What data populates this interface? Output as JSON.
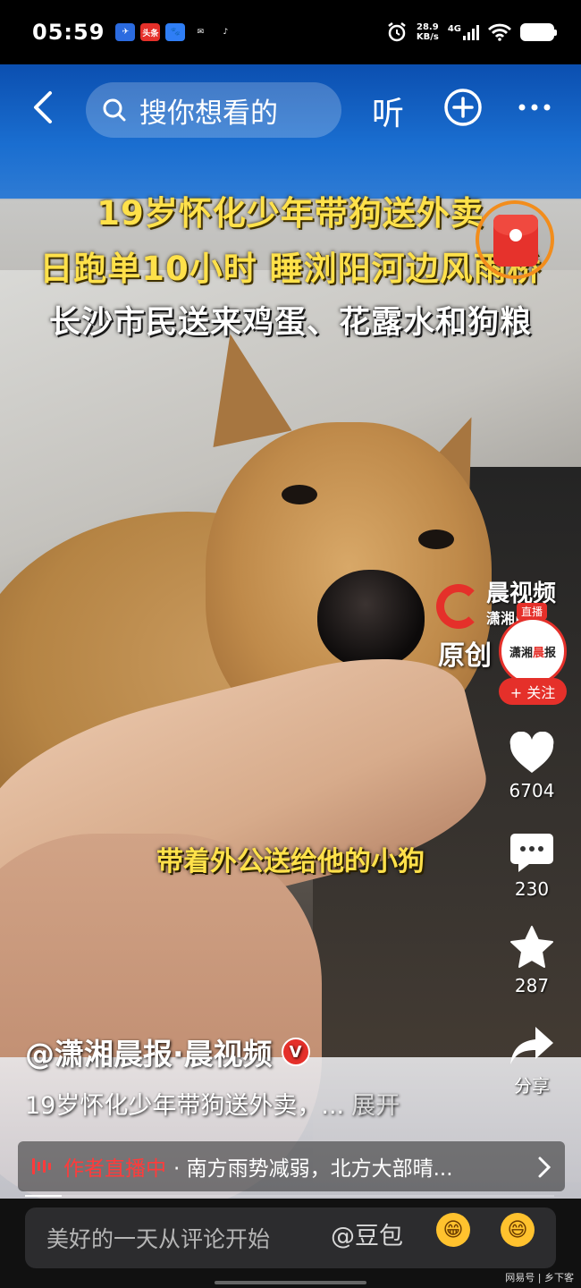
{
  "status_bar": {
    "time": "05:59",
    "apps": [
      {
        "name": "app-icon",
        "color": "#2b6be0",
        "label": ""
      },
      {
        "name": "toutiao-icon",
        "color": "#e5302a",
        "label": "头条"
      },
      {
        "name": "baidu-icon",
        "color": "#2f7ef5",
        "label": ""
      },
      {
        "name": "mail-icon",
        "color": "#000000",
        "label": "✉"
      },
      {
        "name": "tiktok-icon",
        "color": "#000000",
        "label": "♪"
      }
    ],
    "net_speed_value": "28.9",
    "net_speed_unit": "KB/s",
    "network": "4G"
  },
  "nav": {
    "search_placeholder": "搜你想看的",
    "listen_label": "听"
  },
  "video": {
    "headline_1": "19岁怀化少年带狗送外卖",
    "headline_2": "日跑单10小时 睡浏阳河边风雨桥",
    "headline_3": "长沙市民送来鸡蛋、花露水和狗粮",
    "subtitle": "带着外公送给他的小狗",
    "watermark_title": "晨视频",
    "watermark_sub": "潇湘晨报",
    "watermark_original": "原创"
  },
  "rail": {
    "avatar_text_1": "潇湘",
    "avatar_text_2": "晨",
    "avatar_text_3": "报",
    "live_tag": "直播",
    "follow_label": "+ 关注",
    "likes": "6704",
    "comments": "230",
    "favorites": "287",
    "share_label": "分享"
  },
  "caption": {
    "author": "@潇湘晨报·晨视频",
    "verified": "V",
    "description": "19岁怀化少年带狗送外卖，...",
    "expand_label": "展开",
    "live_label": "作者直播中",
    "live_text": "· 南方雨势减弱，北方大部晴..."
  },
  "progress_fraction": 0.07,
  "comment_bar": {
    "placeholder": "美好的一天从评论开始",
    "doubao_label": "@豆包"
  },
  "source_tag": "网易号 | 乡下客",
  "colors": {
    "accent_red": "#e5302a",
    "headline_yellow": "#ffe14a"
  }
}
